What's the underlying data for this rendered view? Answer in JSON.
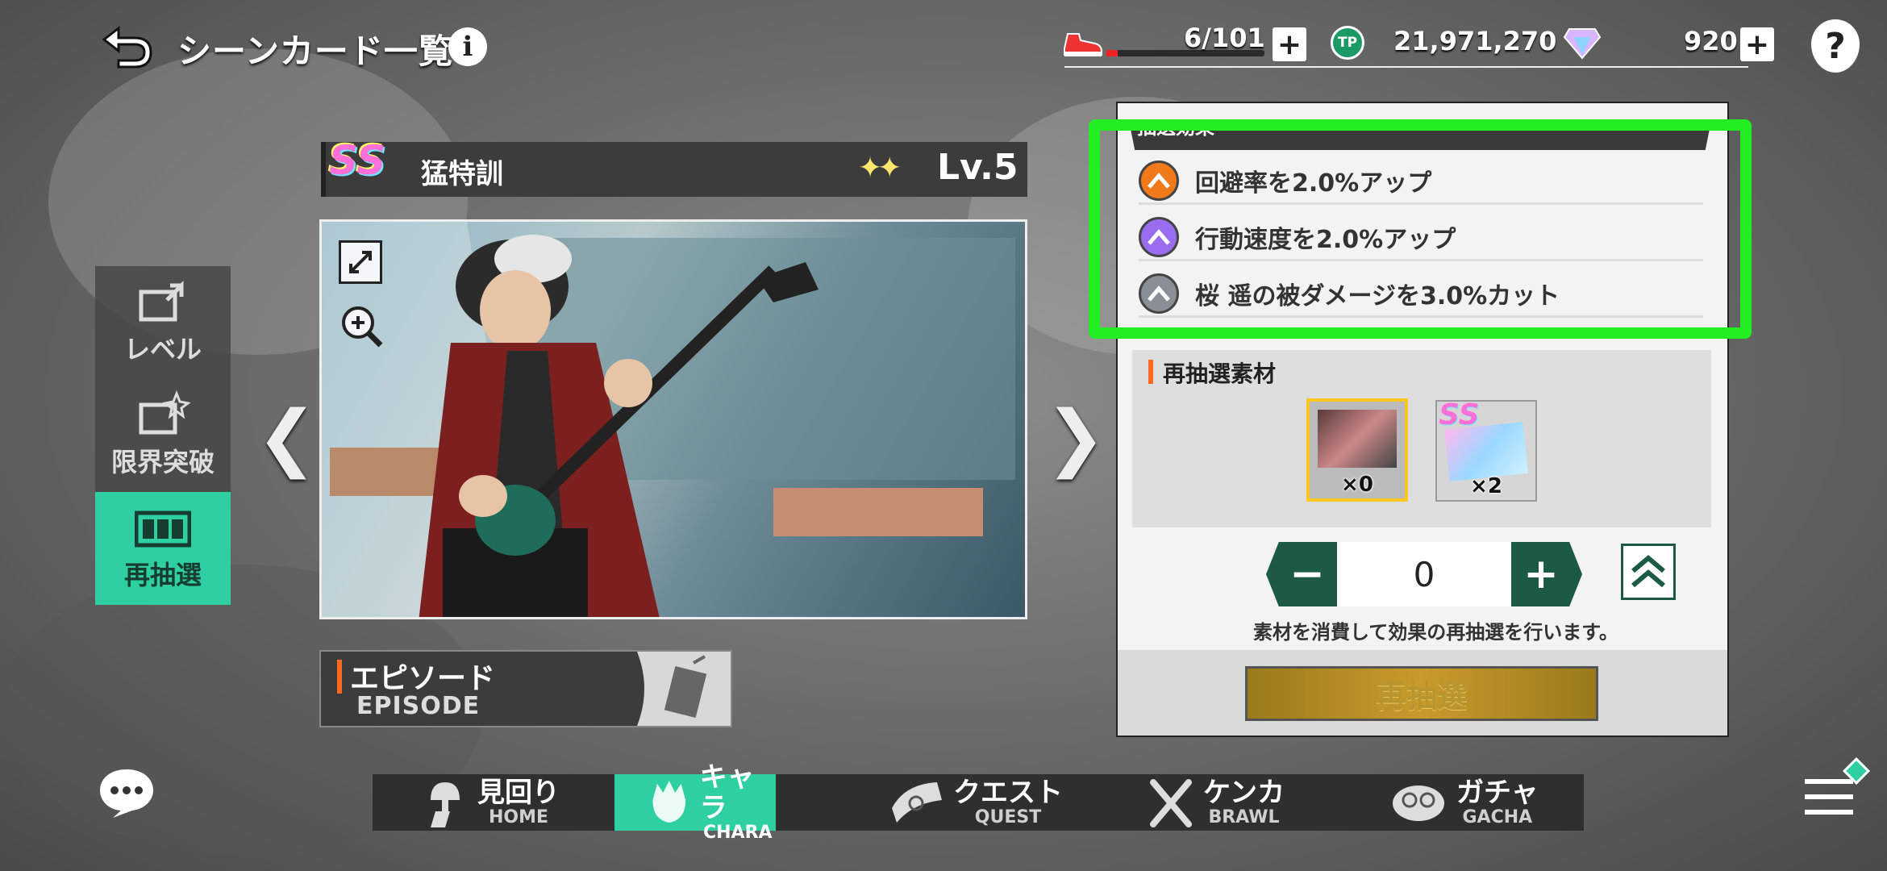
{
  "header": {
    "title": "シーンカード一覧",
    "stamina": "6/101",
    "tp": "21,971,270",
    "gems": "920"
  },
  "side_tabs": [
    {
      "label": "レベル"
    },
    {
      "label": "限界突破"
    },
    {
      "label": "再抽選"
    }
  ],
  "card": {
    "rarity": "SS",
    "name": "猛特訓",
    "level": "Lv.5"
  },
  "episode": {
    "label_jp": "エピソード",
    "label_en": "EPISODE"
  },
  "effects": {
    "header": "抽選効果",
    "items": [
      {
        "text": "回避率を2.0%アップ",
        "color": "#f07a1a"
      },
      {
        "text": "行動速度を2.0%アップ",
        "color": "#9a6cf0"
      },
      {
        "text": "桜 遥の被ダメージを3.0%カット",
        "color": "#8a8f96"
      }
    ]
  },
  "materials": {
    "title": "再抽選素材",
    "items": [
      {
        "count": "×0"
      },
      {
        "count": "×2",
        "rarity": "SS"
      }
    ]
  },
  "stepper": {
    "value": "0"
  },
  "hint": "素材を消費して効果の再抽選を行います。",
  "redraw_button": "再抽選",
  "nav": [
    {
      "jp": "見回り",
      "en": "HOME"
    },
    {
      "jp": "キャラ",
      "en": "CHARA"
    },
    {
      "jp": "クエスト",
      "en": "QUEST"
    },
    {
      "jp": "ケンカ",
      "en": "BRAWL"
    },
    {
      "jp": "ガチャ",
      "en": "GACHA"
    }
  ],
  "colors": {
    "accent": "#2ecfa0",
    "highlight": "#22ee22",
    "stepper": "#1c5a46"
  }
}
